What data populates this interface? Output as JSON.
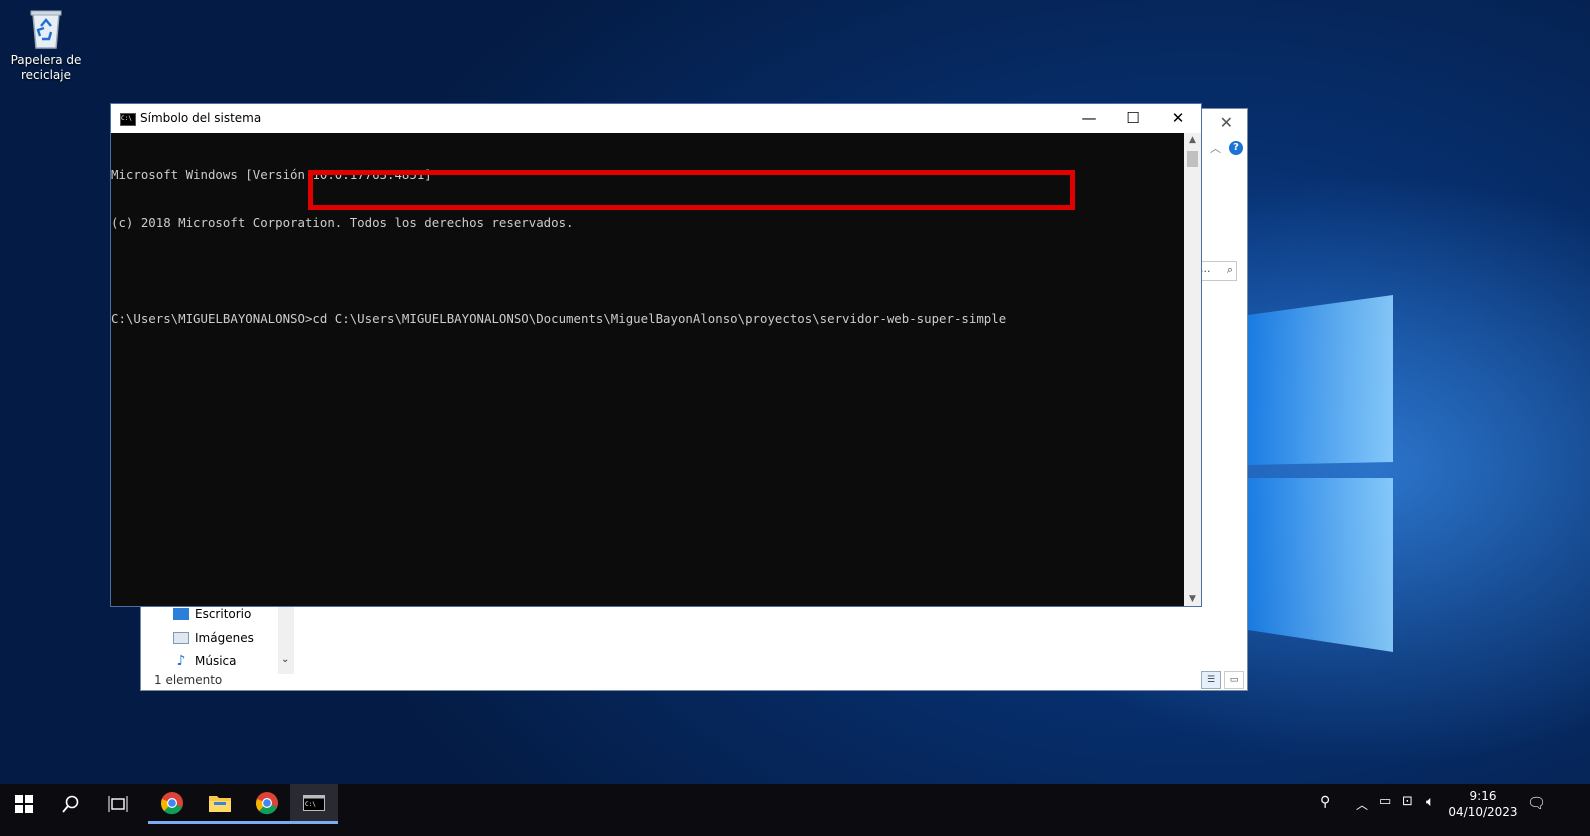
{
  "desktop": {
    "recycle_bin_label_1": "Papelera de",
    "recycle_bin_label_2": "reciclaje"
  },
  "explorer": {
    "nav_items": [
      {
        "label": "Escritorio",
        "icon": "desktop-folder-icon"
      },
      {
        "label": "Imágenes",
        "icon": "pictures-folder-icon"
      },
      {
        "label": "Música",
        "icon": "music-note-icon"
      }
    ],
    "status": "1 elemento",
    "search_placeholder": "..."
  },
  "cmd": {
    "title": "Símbolo del sistema",
    "lines": [
      "Microsoft Windows [Versión 10.0.17763.4851]",
      "(c) 2018 Microsoft Corporation. Todos los derechos reservados.",
      "",
      "C:\\Users\\MIGUELBAYONALONSO>cd C:\\Users\\MIGUELBAYONALONSO\\Documents\\MiguelBayonAlonso\\proyectos\\servidor-web-super-simple"
    ],
    "highlight_color": "#e00000"
  },
  "taskbar": {
    "clock_time": "9:16",
    "clock_date": "04/10/2023"
  }
}
